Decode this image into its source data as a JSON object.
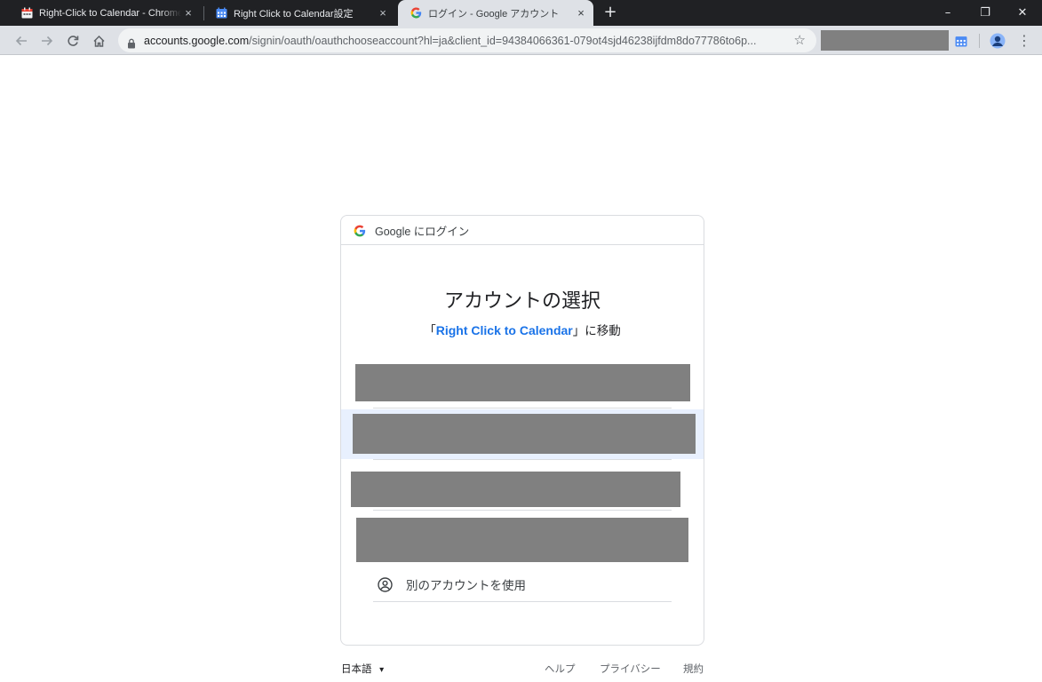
{
  "browser": {
    "tabs": [
      {
        "title": "Right-Click to Calendar - Chrome",
        "icon": "calendar-extension-icon",
        "active": false
      },
      {
        "title": "Right Click to Calendar設定",
        "icon": "calendar-icon",
        "active": false
      },
      {
        "title": "ログイン - Google アカウント",
        "icon": "google-g-icon",
        "active": true
      }
    ],
    "tab_close_glyph": "×",
    "new_tab_glyph": "+",
    "window_controls": {
      "minimize": "–",
      "restore": "❐",
      "close": "✕"
    },
    "nav": {
      "back": "←",
      "forward": "→",
      "reload": "↻",
      "home": "⌂"
    },
    "address": {
      "host": "accounts.google.com",
      "path": "/signin/oauth/oauthchooseaccount?hl=ja&client_id=94384066361-079ot4sjd46238ijfdm8do77786to6p..."
    },
    "star_glyph": "☆",
    "menu_glyph": "⋮"
  },
  "signin": {
    "header": "Google にログイン",
    "title": "アカウントの選択",
    "subtitle_prefix": "「",
    "app_name": "Right Click to Calendar",
    "subtitle_suffix": "」に移動",
    "use_another_account": "別のアカウントを使用"
  },
  "footer": {
    "language": "日本語",
    "language_caret": "▾",
    "help": "ヘルプ",
    "privacy": "プライバシー",
    "terms": "規約"
  },
  "colors": {
    "tabstrip": "#202124",
    "toolbar": "#dee1e6",
    "link_blue": "#1a73e8",
    "selected_row": "#e8f0fe",
    "redaction": "#808080"
  }
}
